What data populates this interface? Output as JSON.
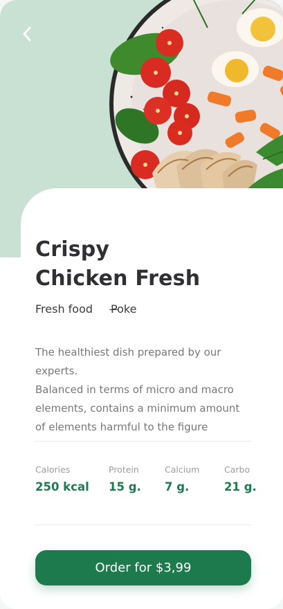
{
  "colors": {
    "header_bg": "#c9e1d2",
    "accent": "#1c7a4c",
    "title_text": "#2f2f34",
    "muted_text": "#77777c"
  },
  "header": {
    "back_icon": "chevron-left-icon"
  },
  "product": {
    "title_line1": "Crispy",
    "title_line2": "Chicken Fresh",
    "tags": [
      "Fresh food",
      "Poke"
    ],
    "description_lines": [
      "The healthiest dish prepared by our experts.",
      "Balanced in terms of micro and macro",
      "elements, contains a minimum amount",
      "of elements harmful to the figure"
    ]
  },
  "nutrition": [
    {
      "label": "Calories",
      "value": "250 kcal"
    },
    {
      "label": "Protein",
      "value": "15 g."
    },
    {
      "label": "Calcium",
      "value": "7 g."
    },
    {
      "label": "Carbo",
      "value": "21 g."
    }
  ],
  "order": {
    "label": "Order for $3,99"
  }
}
